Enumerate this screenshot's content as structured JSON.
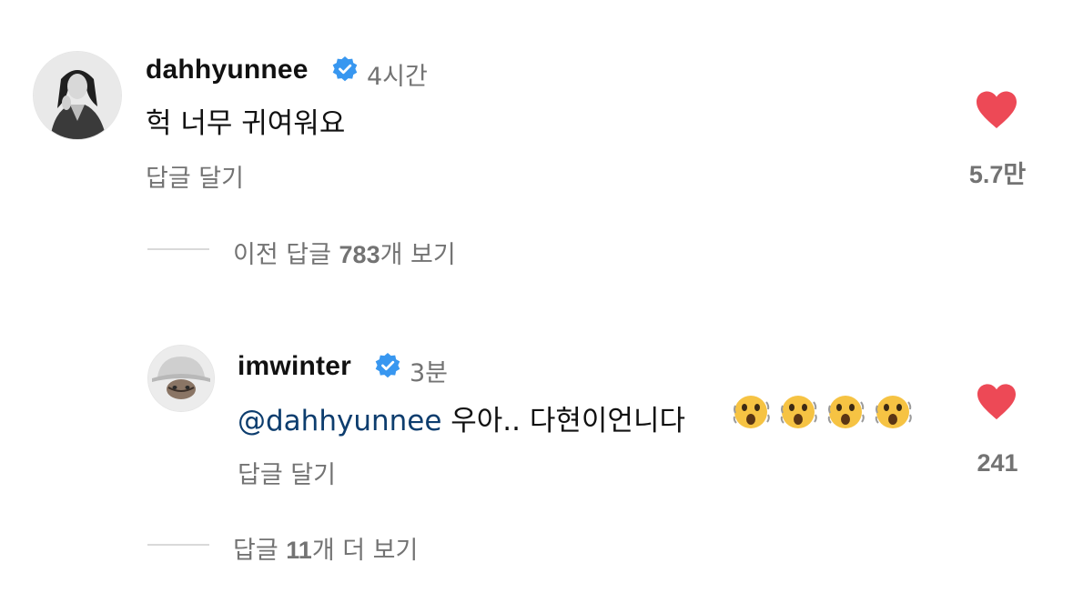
{
  "comment": {
    "username": "dahhyunnee",
    "time": "4시간",
    "text": "헉 너무 귀여워요",
    "reply_label": "답글 달기",
    "like_count": "5.7만",
    "icons": {
      "avatar": "profile-photo",
      "verified": "verified-badge-icon",
      "like": "heart-icon"
    }
  },
  "view_previous": {
    "prefix": "이전 답글 ",
    "count": "783",
    "suffix": "개 보기"
  },
  "reply": {
    "username": "imwinter",
    "time": "3분",
    "mention": "@dahhyunnee",
    "text": " 우아.. 다현이언니다",
    "emoji_count": 4,
    "reply_label": "답글 달기",
    "like_count": "241",
    "icons": {
      "avatar": "profile-photo",
      "verified": "verified-badge-icon",
      "like": "heart-icon",
      "emoji": "astonished-face-emoji"
    }
  },
  "view_more": {
    "prefix": "답글 ",
    "count": "11",
    "suffix": "개 더 보기"
  },
  "colors": {
    "heart": "#ed4956",
    "verified": "#3897f0",
    "secondary_text": "#737373",
    "mention": "#0d3d6e"
  }
}
